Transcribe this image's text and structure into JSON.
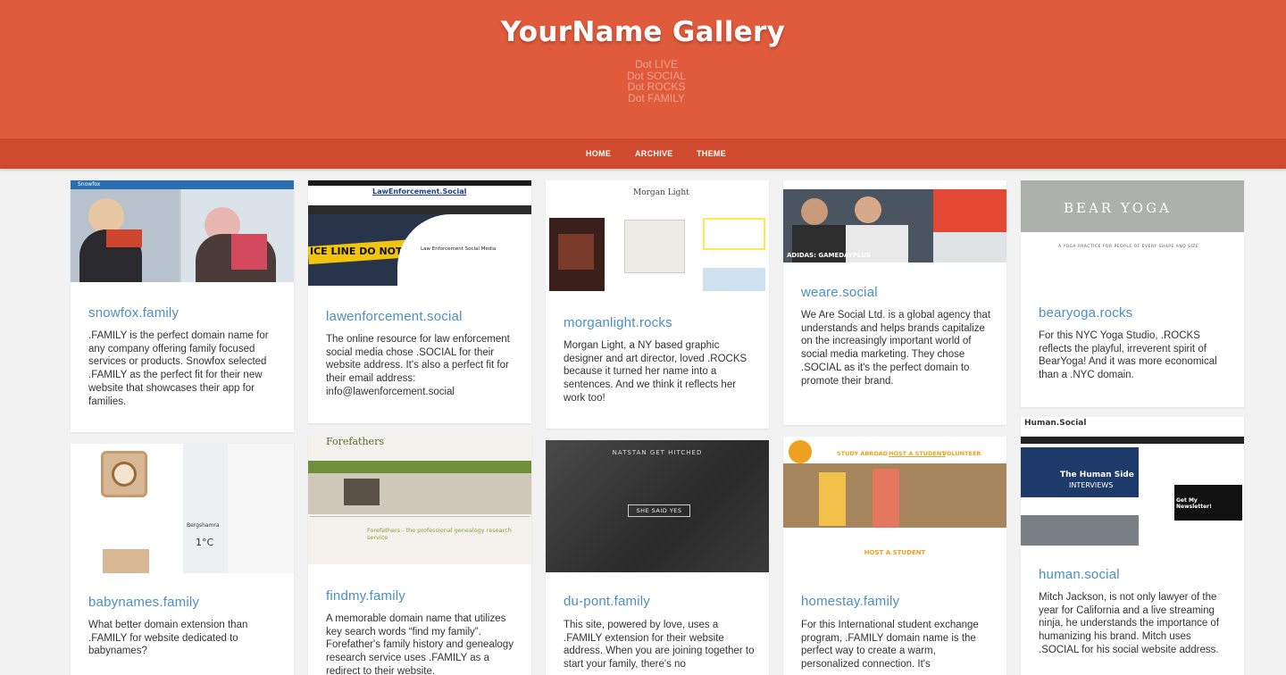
{
  "header": {
    "title": "YourName Gallery",
    "taglines": [
      "Dot LIVE",
      "Dot SOCIAL",
      "Dot ROCKS",
      "Dot FAMILY"
    ]
  },
  "nav": {
    "items": [
      "HOME",
      "ARCHIVE",
      "THEME"
    ]
  },
  "cards": [
    {
      "title": "snowfox.family",
      "desc": ".FAMILY is the perfect domain name for any company offering family focused services or products. Snowfox selected .FAMILY as the perfect fit for their new website that showcases their app for families.",
      "thumb": {
        "logo": "Snowfox"
      }
    },
    {
      "title": "lawenforcement.social",
      "desc": "The online resource for law enforcement social media chose .SOCIAL for their website address. It's also a perfect fit for their email address: info@lawenforcement.social",
      "thumb": {
        "logo": "LawEnforcement.Social",
        "heading": "Law Enforcement Social Media",
        "tape": "ICE LINE DO NOT"
      }
    },
    {
      "title": "morganlight.rocks",
      "desc": "Morgan Light, a NY based graphic designer and art director, loved .ROCKS because it turned her name into a sentences. And we think it reflects her work too!",
      "thumb": {
        "logo": "Morgan Light"
      }
    },
    {
      "title": "weare.social",
      "desc": "We Are Social Ltd. is a global agency that understands and helps brands capitalize on the increasingly important world of social media marketing. They chose .SOCIAL as it's the perfect domain to promote their brand.",
      "thumb": {
        "caption": "ADIDAS: GAMEDAYPLUS"
      }
    },
    {
      "title": "bearyoga.rocks",
      "desc": "For this NYC Yoga Studio, .ROCKS reflects the playful, irreverent spirit of BearYoga!  And it was more economical than a .NYC domain.",
      "thumb": {
        "logo": "BEAR YOGA",
        "tagline": "A YOGA PRACTICE FOR PEOPLE OF EVERY SHAPE AND SIZE"
      }
    },
    {
      "title": "babynames.family",
      "desc": "What better domain extension than .FAMILY for website dedicated to babynames?",
      "thumb": {
        "temp": "1°C",
        "city": "Bergshamra"
      }
    },
    {
      "title": "findmy.family",
      "desc": "A memorable domain name that utilizes key search words “find my family”. Forefather's family history and genealogy research service uses .FAMILY as a redirect to their website.",
      "thumb": {
        "logo": "Forefathers",
        "heading": "Forefathers - the professional genealogy research service"
      }
    },
    {
      "title": "du-pont.family",
      "desc": "This site, powered by love, uses a .FAMILY extension for their website address. When you are joining together to start your family, there's no",
      "thumb": {
        "heading": "NATSTAN GET HITCHED",
        "button": "SHE SAID YES"
      }
    },
    {
      "title": "homestay.family",
      "desc": "For this International student exchange program, .FAMILY domain name is the perfect way to create a warm, personalized connection.  It's",
      "thumb": {
        "heading": "HOST A STUDENT",
        "menu": [
          "STUDY ABROAD",
          "HOST A STUDENT",
          "VOLUNTEER"
        ]
      }
    },
    {
      "title": "human.social",
      "desc": "Mitch Jackson, is not only lawyer of the year for California and a live streaming ninja, he understands the importance of humanizing his brand. Mitch uses .SOCIAL for his social website address.",
      "thumb": {
        "logo": "Human.Social",
        "heading": "The Human Side",
        "sub": "INTERVIEWS",
        "promo": "Get My Newsletter!"
      }
    }
  ],
  "colors": {
    "header": "#e05a3c",
    "nav": "#cf4a2e",
    "link": "#4a8fc6",
    "text": "#333333"
  }
}
